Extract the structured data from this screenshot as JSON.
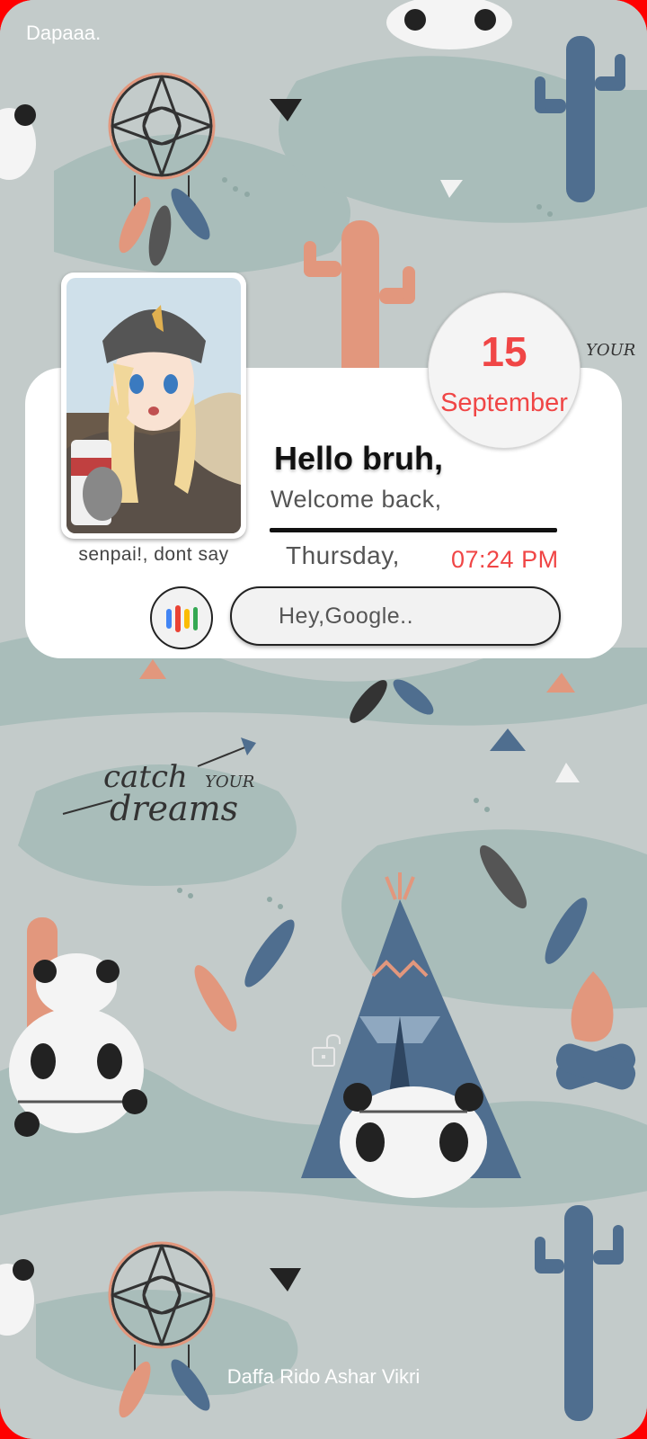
{
  "status_bar": {
    "carrier": "Dapaaa."
  },
  "widget": {
    "photo_caption": "senpai!, dont say",
    "date": {
      "day": "15",
      "month": "September"
    },
    "greeting": "Hello bruh,",
    "welcome": "Welcome back,",
    "weekday": "Thursday,",
    "time": "07:24 PM",
    "assistant": {
      "icon": "google-mic-icon",
      "placeholder": "Hey,Google.."
    }
  },
  "wallpaper": {
    "text": [
      "catch your",
      "dreams"
    ]
  },
  "lock_screen": {
    "lock_icon": "unlock-icon",
    "owner_text": "Daffa Rido Ashar Vikri"
  },
  "colors": {
    "accent_red": "#f04646",
    "frame": "#ff0000",
    "wallpaper_bg": "#c3cbca"
  }
}
